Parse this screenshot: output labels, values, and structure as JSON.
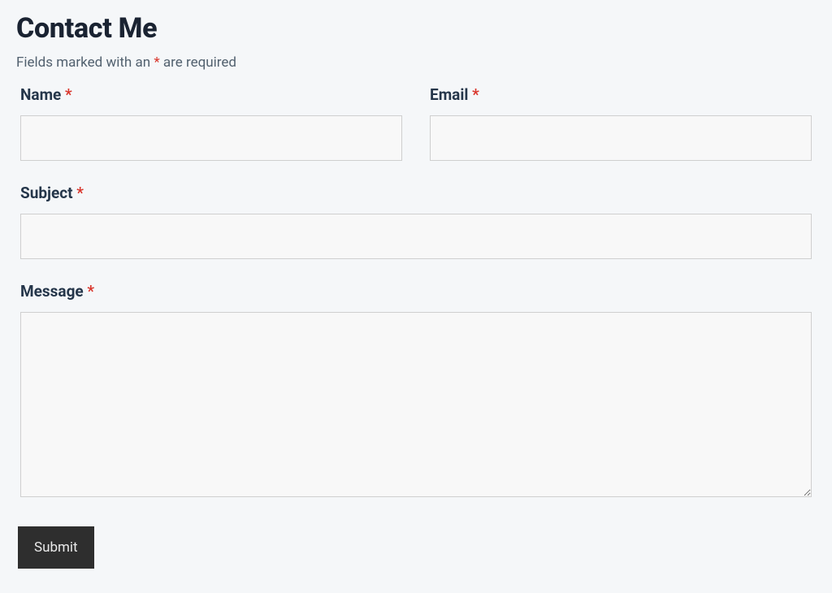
{
  "form": {
    "title": "Contact Me",
    "required_note_prefix": "Fields marked with an ",
    "required_note_suffix": " are required",
    "asterisk": "*",
    "fields": {
      "name": {
        "label": "Name ",
        "value": ""
      },
      "email": {
        "label": "Email ",
        "value": ""
      },
      "subject": {
        "label": "Subject ",
        "value": ""
      },
      "message": {
        "label": "Message ",
        "value": ""
      }
    },
    "submit_label": "Submit"
  }
}
